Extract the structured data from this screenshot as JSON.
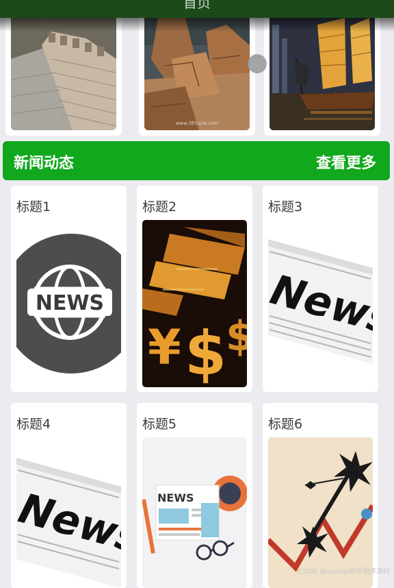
{
  "header": {
    "title": "首页"
  },
  "banner": {
    "images": [
      {
        "icon": "great-wall-photo"
      },
      {
        "icon": "rock-formation-photo",
        "caption": "www.365azw.com"
      },
      {
        "icon": "junk-boat-photo"
      }
    ]
  },
  "news_section": {
    "title": "新闻动态",
    "more_label": "查看更多",
    "accent_color": "#12a81e",
    "items": [
      {
        "title": "标题1",
        "icon": "globe-news-icon"
      },
      {
        "title": "标题2",
        "icon": "gold-currency-icon"
      },
      {
        "title": "标题3",
        "icon": "newspaper-icon"
      },
      {
        "title": "标题4",
        "icon": "newspaper-icon"
      },
      {
        "title": "标题5",
        "icon": "news-flat-illustration-icon"
      },
      {
        "title": "标题6",
        "icon": "market-crash-chart-icon"
      }
    ]
  },
  "watermark": "CSDN @nodejs毕设程序源码"
}
